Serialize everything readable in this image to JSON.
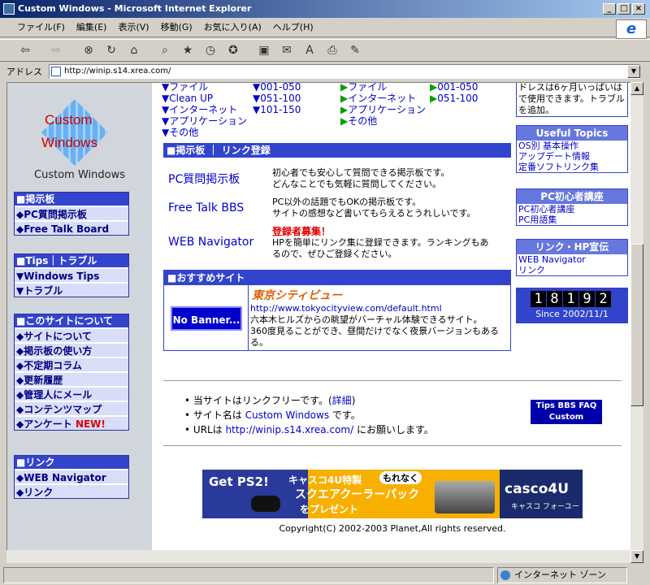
{
  "window": {
    "title": "Custom Windows - Microsoft Internet Explorer"
  },
  "menu": [
    "ファイル(F)",
    "編集(E)",
    "表示(V)",
    "移動(G)",
    "お気に入り(A)",
    "ヘルプ(H)"
  ],
  "address": {
    "label": "アドレス",
    "url": "http://winip.s14.xrea.com/"
  },
  "status": {
    "zone": "インターネット ゾーン"
  },
  "sidebar": {
    "logo_line1": "Custom",
    "logo_line2": "Windows",
    "site_name": "Custom Windows",
    "boxes": [
      {
        "head": "■掲示板",
        "items": [
          "◆PC質問掲示板",
          "◆Free Talk Board"
        ]
      },
      {
        "head": "■Tips｜トラブル",
        "items": [
          "▼Windows Tips",
          "▼トラブル"
        ]
      },
      {
        "head": "■このサイトについて",
        "items": [
          "◆サイトについて",
          "◆掲示板の使い方",
          "◆不定期コラム",
          "◆更新履歴",
          "◆管理人にメール",
          "◆コンテンツマップ",
          "◆アンケート"
        ],
        "new_label": "NEW!"
      },
      {
        "head": "■リンク",
        "items": [
          "◆WEB Navigator",
          "◆リンク"
        ]
      }
    ]
  },
  "top_links": {
    "col1": [
      "ファイル",
      "Clean UP",
      "インターネット",
      "アプリケーション",
      "その他"
    ],
    "col2": [
      "001-050",
      "051-100",
      "101-150"
    ],
    "col3": [
      "ファイル",
      "インターネット",
      "アプリケーション",
      "その他"
    ],
    "col4": [
      "001-050",
      "051-100"
    ]
  },
  "bbs": {
    "head": "■掲示板 ｜ リンク登録",
    "items": [
      {
        "title": "PC質問掲示板",
        "desc1": "初心者でも安心して質問できる掲示板です。",
        "desc2": "どんなことでも気軽に質問してください。"
      },
      {
        "title": "Free Talk BBS",
        "desc1": "PC以外の話題でもOKの掲示板です。",
        "desc2": "サイトの感想など書いてもらえるとうれしいです。"
      },
      {
        "title": "WEB Navigator",
        "notice": "登録者募集！",
        "desc1": "HPを簡単にリンク集に登録できます。ランキングもあ",
        "desc2": "るので、ぜひご登録ください。"
      }
    ]
  },
  "recommend": {
    "head": "■おすすめサイト",
    "banner": "No Banner...",
    "site_title": "東京シティビュー",
    "site_url": "http://www.tokyocityview.com/default.html",
    "desc1": "六本木ヒルズからの眺望がバーチャル体験できるサイト。",
    "desc2": "360度見ることができ、昼間だけでなく夜景バージョンもある",
    "desc3": "る。"
  },
  "right": {
    "top_text1": "ドレスは6ヶ月いっぱいは",
    "top_text2": "で使用できます。トラブル",
    "top_text3": "を追加。",
    "useful": {
      "head": "Useful Topics",
      "items": [
        "OS別 基本操作",
        "アップデート情報",
        "定番ソフトリンク集"
      ]
    },
    "beginner": {
      "head": "PC初心者講座",
      "items": [
        "PC初心者講座",
        "PC用語集"
      ]
    },
    "links": {
      "head": "リンク・HP宣伝",
      "items": [
        "WEB Navigator",
        "リンク"
      ]
    },
    "counter": {
      "digits": [
        "1",
        "8",
        "1",
        "9",
        "2"
      ],
      "since": "Since 2002/11/1"
    }
  },
  "footer": {
    "b1_pre": "当サイトはリンクフリーです。(",
    "b1_link": "詳細",
    "b1_post": ")",
    "b2_pre": "サイト名は ",
    "b2_link": "Custom Windows",
    "b2_post": " です。",
    "b3_pre": "URLは ",
    "b3_link": "http://winip.s14.xrea.com/",
    "b3_post": " にお願いします。",
    "badge1": "Tips BBS FAQ",
    "badge2": "Custom Windows",
    "ad_getps2": "Get PS2!",
    "ad_text1": "キャスコ4U特製",
    "ad_badge": "もれなく",
    "ad_text2": "スクエアクーラーパック",
    "ad_text3": "をプレゼント",
    "ad_brand": "casco4U",
    "ad_brand_sub": "キャスコ フォーユー",
    "copyright": "Copyright(C) 2002-2003 Planet,All rights reserved."
  }
}
